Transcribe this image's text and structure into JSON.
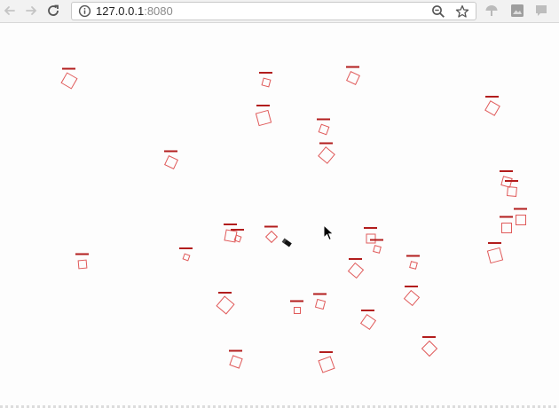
{
  "browser": {
    "url_host": "127.0.0.1",
    "url_port": ":8080",
    "icons": {
      "back": "arrow-left-icon",
      "forward": "arrow-right-icon",
      "reload": "reload-icon",
      "info": "info-icon",
      "zoom": "zoom-out-icon",
      "bookmark": "star-icon",
      "extension_1": "umbrella-extension-icon",
      "extension_2": "image-extension-icon",
      "extension_3": "chat-extension-icon"
    }
  },
  "scene": {
    "box_color": "#e05a5a",
    "health_bar_color": "#b21d1d",
    "cursor": "arrow-cursor-icon",
    "tool": "eraser-icon"
  }
}
